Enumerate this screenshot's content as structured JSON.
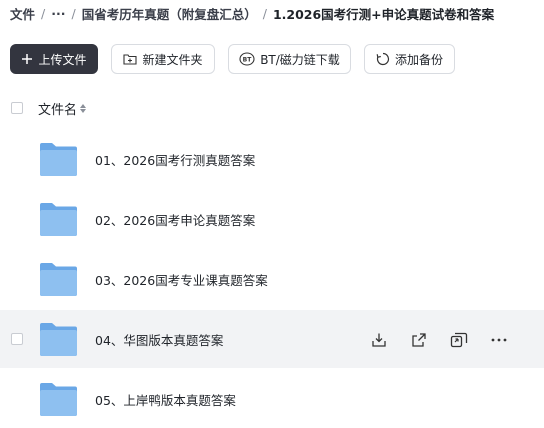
{
  "breadcrumb": {
    "root": "文件",
    "sep": "/",
    "ellipsis": "···",
    "parent": "国省考历年真题（附复盘汇总）",
    "current": "1.2026国考行测+申论真题试卷和答案"
  },
  "toolbar": {
    "upload": "上传文件",
    "new_folder": "新建文件夹",
    "bt": "BT/磁力链下载",
    "backup": "添加备份"
  },
  "list": {
    "header": "文件名",
    "items": [
      {
        "name": "01、2026国考行测真题答案"
      },
      {
        "name": "02、2026国考申论真题答案"
      },
      {
        "name": "03、2026国考专业课真题答案"
      },
      {
        "name": "04、华图版本真题答案"
      },
      {
        "name": "05、上岸鸭版本真题答案"
      }
    ]
  },
  "colors": {
    "folder": "#7fb5ec",
    "primary_button": "#33353f",
    "hover_row": "#f2f3f5"
  },
  "icons": {
    "row_actions": [
      "download-icon",
      "share-icon",
      "move-icon",
      "more-icon"
    ]
  }
}
